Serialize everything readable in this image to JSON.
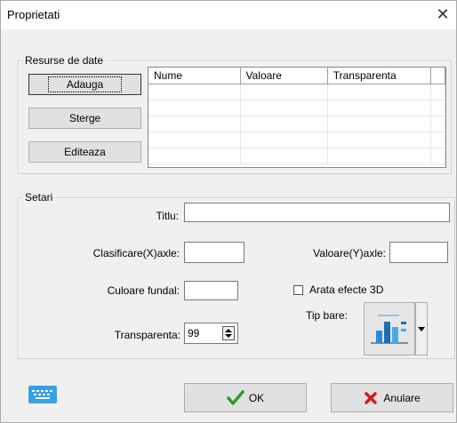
{
  "window": {
    "title": "Proprietati"
  },
  "data_sources": {
    "legend": "Resurse de date",
    "buttons": {
      "add": "Adauga",
      "delete": "Sterge",
      "edit": "Editeaza"
    },
    "columns": [
      "Nume",
      "Valoare",
      "Transparenta"
    ]
  },
  "settings": {
    "legend": "Setari",
    "title_label": "Titlu:",
    "title_value": "",
    "x_axis_label": "Clasificare(X)axle:",
    "x_axis_value": "",
    "y_axis_label": "Valoare(Y)axle:",
    "y_axis_value": "",
    "background_color_label": "Culoare fundal:",
    "show_3d_label": "Arata efecte 3D",
    "show_3d_checked": false,
    "bar_type_label": "Tip bare:",
    "transparency_label": "Transparenta:",
    "transparency_value": "99"
  },
  "footer": {
    "ok_label": "OK",
    "cancel_label": "Anulare"
  },
  "icons": {
    "keyboard": "keyboard-icon",
    "check": "checkmark-icon",
    "cancel": "x-icon",
    "chart": "bar-chart-icon"
  },
  "colors": {
    "ok_check": "#2e9b2e",
    "cancel_x": "#cc1e1e",
    "keyboard": "#3aa0e6"
  }
}
